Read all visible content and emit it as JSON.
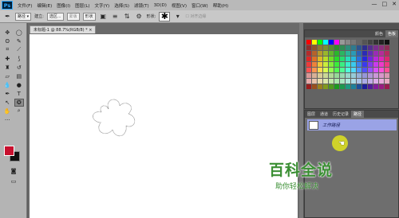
{
  "app": {
    "logo": "Ps"
  },
  "menus": [
    "文件(F)",
    "编辑(E)",
    "图像(I)",
    "图层(L)",
    "文字(Y)",
    "选择(S)",
    "滤镜(T)",
    "3D(D)",
    "视图(V)",
    "窗口(W)",
    "帮助(H)"
  ],
  "window_controls": {
    "minimize": "—",
    "restore": "□",
    "close": "✕"
  },
  "options": {
    "mode_value": "路径",
    "make_label": "建立:",
    "selection_button": "选区...",
    "mask_button": "蒙版",
    "shape_button": "形状",
    "shape_label": "形状:",
    "align_edges_label": "对齐边缘"
  },
  "document": {
    "tab_title": "未标题-1 @ 88.7%(RGB/8) *",
    "tab_close": "×"
  },
  "swatches_panel": {
    "tabs": [
      "颜色",
      "色板"
    ],
    "active_tab": "色板"
  },
  "paths_panel": {
    "tabs": [
      "图层",
      "通道",
      "历史记录",
      "路径"
    ],
    "active_tab": "路径",
    "rows": [
      {
        "label": "工作路径"
      }
    ]
  },
  "colors": {
    "foreground": "#c8102e",
    "background": "#111111",
    "selected_row": "#9aa3e6"
  },
  "watermark": {
    "title": "百科全说",
    "subtitle": "助你轻松解决"
  }
}
